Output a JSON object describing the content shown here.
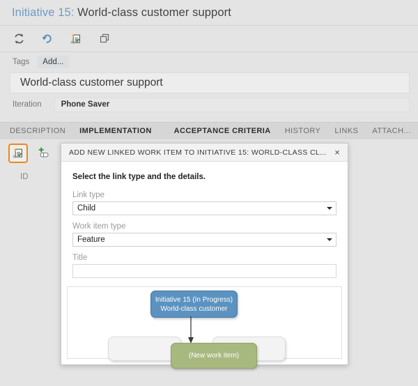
{
  "header": {
    "title_id": "Initiative 15:",
    "title_text": "World-class customer support"
  },
  "toolbar": {
    "buttons": [
      {
        "name": "refresh-icon",
        "label": "Refresh"
      },
      {
        "name": "revert-icon",
        "label": "Revert"
      },
      {
        "name": "new-linked-work-item-icon",
        "label": "New linked work item"
      },
      {
        "name": "copy-icon",
        "label": "Copy"
      }
    ]
  },
  "tags": {
    "label": "Tags",
    "add_label": "Add..."
  },
  "title_field": {
    "value": "World-class customer support"
  },
  "iteration": {
    "label": "Iteration",
    "value": "Phone Saver"
  },
  "tabs": [
    {
      "label": "DESCRIPTION",
      "selected": false
    },
    {
      "label": "IMPLEMENTATION",
      "selected": true
    },
    {
      "label": "ACCEPTANCE CRITERIA",
      "selected": true
    },
    {
      "label": "HISTORY",
      "selected": false
    },
    {
      "label": "LINKS",
      "selected": false
    },
    {
      "label": "ATTACH...",
      "selected": false
    }
  ],
  "links_panel": {
    "new_linked_item_icon": "new-linked-work-item-icon",
    "add_link_icon": "add-link-icon",
    "column_id": "ID"
  },
  "dialog": {
    "title": "ADD NEW LINKED WORK ITEM TO INITIATIVE 15: WORLD-CLASS CL...",
    "close_label": "×",
    "instruction": "Select the link type and the details.",
    "link_type": {
      "label": "Link type",
      "value": "Child"
    },
    "work_item_type": {
      "label": "Work item type",
      "value": "Feature"
    },
    "title_input": {
      "label": "Title",
      "value": "",
      "placeholder": ""
    },
    "diagram": {
      "parent_node": {
        "line1": "Initiative 15 (In Progress)",
        "line2": "World-class customer",
        "color": "#5b92c0"
      },
      "new_node": {
        "label": "(New work item)",
        "color": "#a7b97f"
      },
      "ghost_left": "",
      "ghost_right": ""
    }
  },
  "colors": {
    "accent_orange": "#f0861c",
    "chrome_gray": "#e4e4e4",
    "tab_bar": "#d6d6d6",
    "title_blue": "#6f9bc4"
  }
}
